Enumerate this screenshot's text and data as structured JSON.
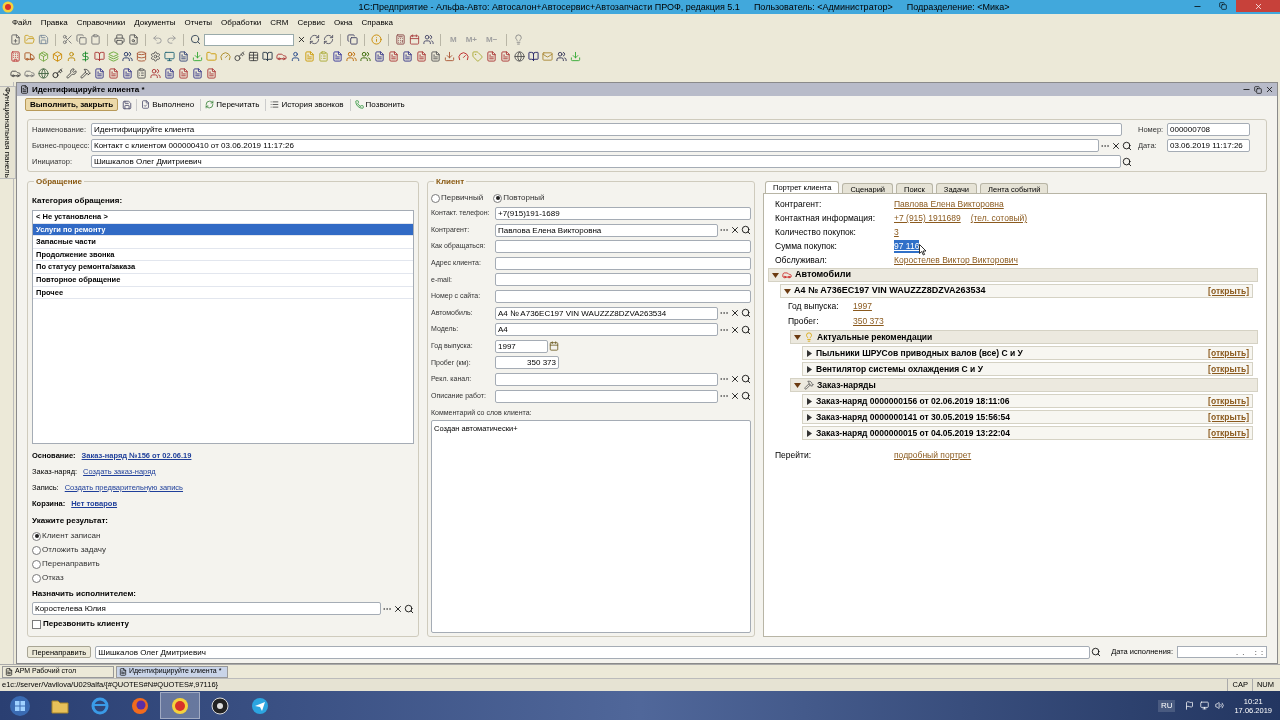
{
  "title_bar": {
    "title": "1С:Предприятие - Альфа-Авто: Автосалон+Автосервис+Автозапчасти ПРОФ, редакция 5.1",
    "user": "Пользователь: <Администратор>",
    "department": "Подразделение: <Мика>"
  },
  "menu": [
    "Файл",
    "Правка",
    "Справочники",
    "Документы",
    "Отчеты",
    "Обработки",
    "CRM",
    "Сервис",
    "Окна",
    "Справка"
  ],
  "memory_buttons": [
    {
      "label": "M",
      "disabled": true
    },
    {
      "label": "M+",
      "disabled": true
    },
    {
      "label": "M−",
      "disabled": true
    }
  ],
  "side_panel": {
    "title": "Функциональная панель"
  },
  "document": {
    "title": "Идентифицируйте клиента *",
    "actions": [
      {
        "label": "Выполнить, закрыть",
        "kind": "primary"
      },
      {
        "kind": "save"
      },
      {
        "label": "Выполнено",
        "kind": "done"
      },
      {
        "label": "Перечитать",
        "kind": "reload"
      },
      {
        "label": "История звонков",
        "kind": "history"
      },
      {
        "label": "Позвонить",
        "kind": "call"
      }
    ]
  },
  "header": {
    "fields": [
      {
        "label": "Наименование:",
        "value": "Идентифицируйте клиента",
        "kind": "text"
      },
      {
        "label": "Бизнес-процесс:",
        "value": "Контакт с клиентом 000000410 от 03.06.2019 11:17:26",
        "kind": "choice"
      },
      {
        "label": "Инициатор:",
        "value": "Шишкалов Олег Дмитриевич",
        "kind": "search"
      }
    ],
    "number": {
      "label": "Номер:",
      "value": "000000708"
    },
    "date": {
      "label": "Дата:",
      "value": "03.06.2019 11:17:26"
    }
  },
  "request": {
    "title": "Обращение",
    "category_label": "Категория обращения:",
    "categories": [
      {
        "label": "< Не установлена >",
        "selected": false
      },
      {
        "label": "Услуги по ремонту",
        "selected": true
      },
      {
        "label": "Запасные части",
        "selected": false
      },
      {
        "label": "Продолжение звонка",
        "selected": false
      },
      {
        "label": "По статусу ремонта/заказа",
        "selected": false
      },
      {
        "label": "Повторное обращение",
        "selected": false
      },
      {
        "label": "Прочее",
        "selected": false
      }
    ],
    "links": [
      {
        "label": "Основание:",
        "value": "Заказ-наряд №156 от 02.06.19",
        "bold": true
      },
      {
        "label": "Заказ-наряд:",
        "value": "Создать заказ-наряд",
        "bold": false
      },
      {
        "label": "Запись:",
        "value": "Создать предварительную запись",
        "bold": false
      },
      {
        "label": "Корзина:",
        "value": "Нет товаров",
        "bold": true
      }
    ],
    "result_label": "Укажите результат:",
    "results": [
      {
        "label": "Клиент записан",
        "selected": true
      },
      {
        "label": "Отложить задачу",
        "selected": false
      },
      {
        "label": "Перенаправить",
        "selected": false
      },
      {
        "label": "Отказ",
        "selected": false
      }
    ],
    "assignee_label": "Назначить исполнителем:",
    "assignee": "Коростелева Юлия",
    "callback": {
      "label": "Перезвонить клиенту",
      "checked": false
    }
  },
  "client": {
    "title": "Клиент",
    "types": [
      {
        "label": "Первичный",
        "selected": false
      },
      {
        "label": "Повторный",
        "selected": true
      }
    ],
    "fields": [
      {
        "label": "Контакт. телефон:",
        "value": "+7(915)191-1689",
        "kind": "text"
      },
      {
        "label": "Контрагент:",
        "value": "Павлова Елена Викторовна",
        "kind": "choice"
      },
      {
        "label": "Как обращаться:",
        "kind": "text"
      },
      {
        "label": "Адрес клиента:",
        "kind": "text"
      },
      {
        "label": "e-mail:",
        "kind": "text"
      },
      {
        "label": "Номер с сайта:",
        "kind": "text"
      },
      {
        "label": "Автомобиль:",
        "value": "A4 № A736EC197 VIN WAUZZZ8DZVA263534",
        "kind": "choice"
      },
      {
        "label": "Модель:",
        "value": "A4",
        "kind": "choice"
      },
      {
        "label": "Год выпуска:",
        "value": "1997",
        "kind": "date"
      },
      {
        "label": "Пробег (км):",
        "value": "350 373",
        "kind": "number"
      },
      {
        "label": "Рекл. канал:",
        "kind": "choice"
      },
      {
        "label": "Описание работ:",
        "kind": "choice"
      }
    ],
    "comment_label": "Комментарий со слов клиента:",
    "comment": "Создан автоматически+"
  },
  "portrait": {
    "tabs": [
      {
        "label": "Портрет клиента",
        "selected": true
      },
      {
        "label": "Сценарий",
        "selected": false
      },
      {
        "label": "Поиск",
        "selected": false
      },
      {
        "label": "Задачи",
        "selected": false
      },
      {
        "label": "Лента событий",
        "selected": false
      }
    ],
    "facts": [
      {
        "label": "Контрагент:",
        "values": [
          "Павлова Елена Викторовна"
        ],
        "highlighted": false
      },
      {
        "label": "Контактная информация:",
        "values": [
          "+7 (915) 1911689",
          "(тел. сотовый)"
        ],
        "highlighted": false
      },
      {
        "label": "Количество покупок:",
        "values": [
          "3"
        ],
        "highlighted": false
      },
      {
        "label": "Сумма покупок:",
        "values": [
          "97 116"
        ],
        "highlighted": true
      },
      {
        "label": "Обслуживал:",
        "values": [
          "Коростелев Виктор Викторович"
        ],
        "highlighted": false
      }
    ],
    "tree": [
      {
        "kind": "cars",
        "title": "Автомобили",
        "expanded": true,
        "children": [
          {
            "kind": "car",
            "title": "A4 № A736EC197 VIN WAUZZZ8DZVA263534",
            "expanded": true,
            "action": "[открыть]",
            "details": [
              {
                "label": "Год выпуска:",
                "value": "1997"
              },
              {
                "label": "Пробег:",
                "value": "350 373"
              }
            ],
            "children": [
              {
                "kind": "recommendations",
                "title": "Актуальные рекомендации",
                "expanded": true,
                "children": [
                  {
                    "kind": "item",
                    "title": "Пыльники ШРУСов приводных валов (все) С и У",
                    "expanded": false,
                    "action": "[открыть]"
                  },
                  {
                    "kind": "item",
                    "title": "Вентилятор системы охлаждения С и У",
                    "expanded": false,
                    "action": "[открыть]"
                  }
                ]
              },
              {
                "kind": "orders",
                "title": "Заказ-наряды",
                "expanded": true,
                "children": [
                  {
                    "kind": "item",
                    "title": "Заказ-наряд 0000000156 от 02.06.2019 18:11:06",
                    "expanded": false,
                    "action": "[открыть]"
                  },
                  {
                    "kind": "item",
                    "title": "Заказ-наряд 0000000141 от 30.05.2019 15:56:54",
                    "expanded": false,
                    "action": "[открыть]"
                  },
                  {
                    "kind": "item",
                    "title": "Заказ-наряд 0000000015 от 04.05.2019 13:22:04",
                    "expanded": false,
                    "action": "[открыть]"
                  }
                ]
              }
            ]
          }
        ]
      }
    ],
    "goto": {
      "label": "Перейти:",
      "link": "подробный портрет"
    }
  },
  "bottom": {
    "forward_button": "Перенаправить",
    "initiator": "Шишкалов Олег Дмитриевич",
    "due_label": "Дата исполнения:",
    "due_value": ".  .     :  :"
  },
  "window_tabs": [
    {
      "label": "АРМ Рабочий стол",
      "selected": false
    },
    {
      "label": "Идентифицируйте клиента *",
      "selected": true
    }
  ],
  "status_bar": {
    "path": "e1c://server/Vavilova/U029alfa/{#QUOTES#N#QUOTES#,97116}",
    "indicators": [
      "CAP",
      "NUM"
    ]
  },
  "taskbar": {
    "apps": [
      {
        "kind": "folder",
        "selected": false
      },
      {
        "kind": "browser",
        "selected": false
      },
      {
        "kind": "fox",
        "selected": false
      },
      {
        "kind": "onec",
        "selected": true
      },
      {
        "kind": "record",
        "selected": false
      },
      {
        "kind": "messenger",
        "selected": false
      }
    ],
    "language": "RU",
    "time": "10:21",
    "date": "17.06.2019"
  }
}
